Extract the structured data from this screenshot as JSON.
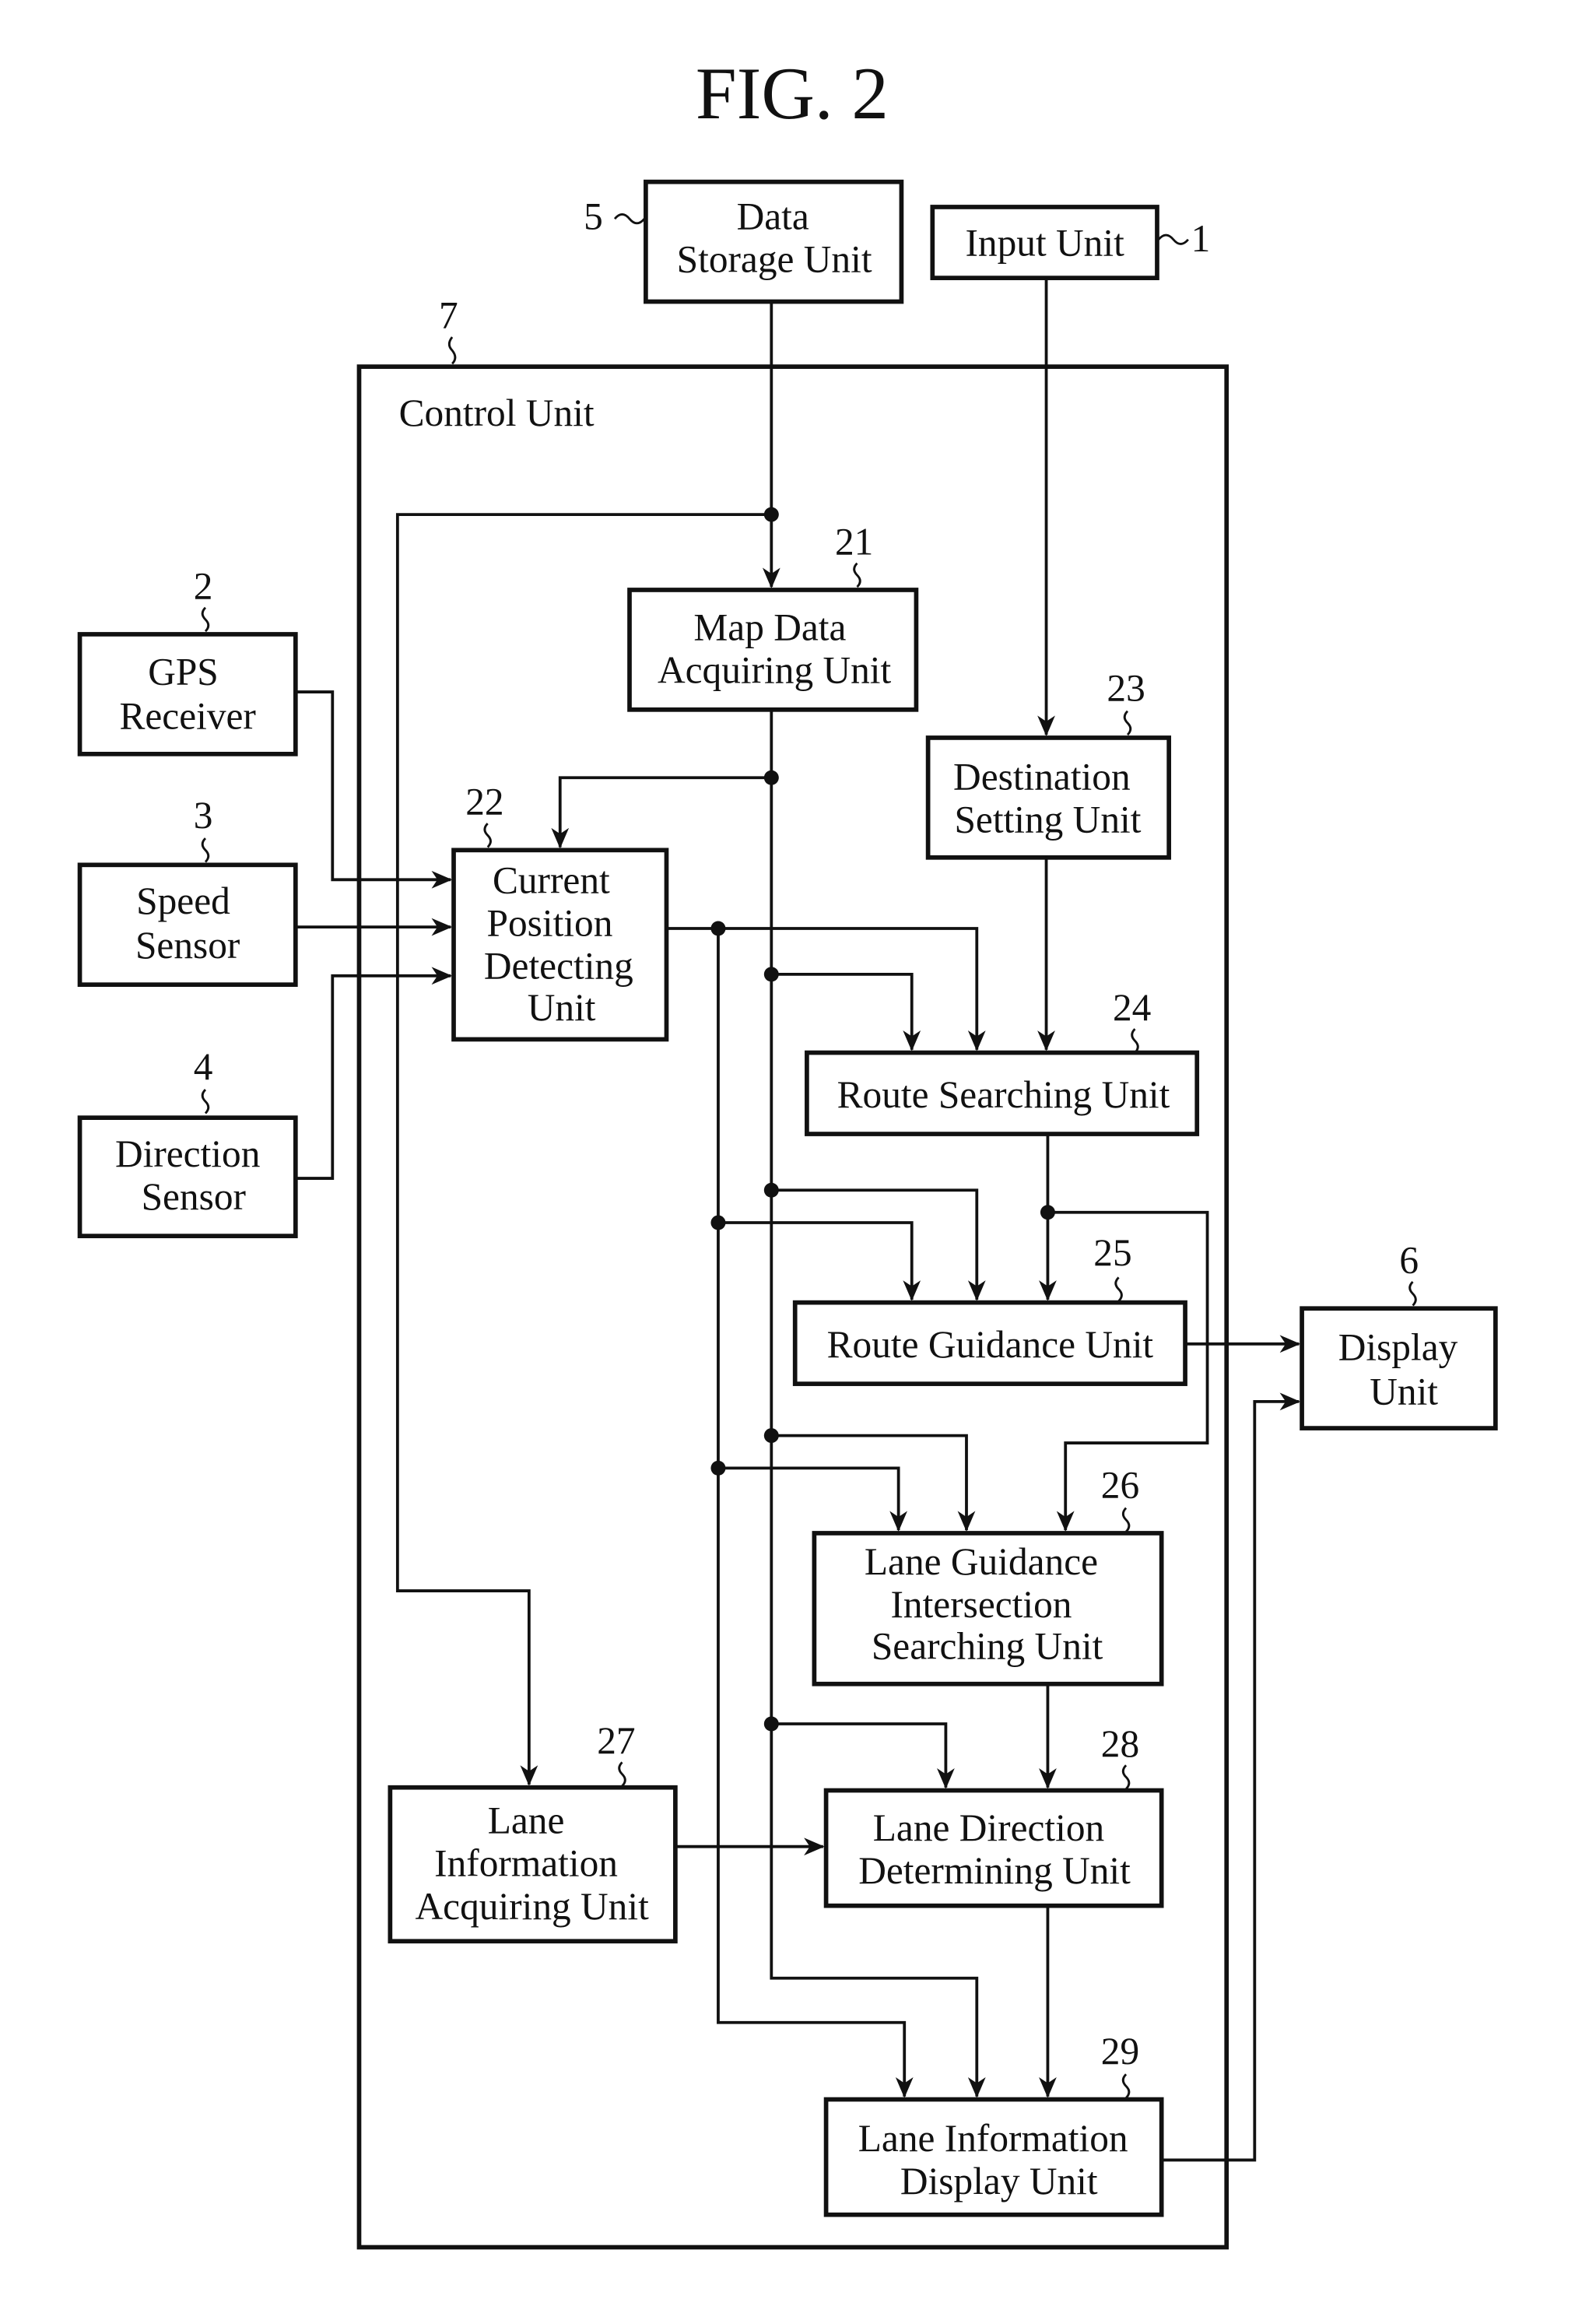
{
  "figure": {
    "title": "FIG. 2",
    "colors": {
      "ink": "#111111",
      "background": "#ffffff"
    }
  },
  "container": {
    "label": "Control Unit",
    "ref": "7"
  },
  "blocks": {
    "data_storage": {
      "ref": "5",
      "lines": [
        "Data",
        "Storage Unit"
      ]
    },
    "input": {
      "ref": "1",
      "lines": [
        "Input Unit"
      ]
    },
    "gps": {
      "ref": "2",
      "lines": [
        "GPS",
        "Receiver"
      ]
    },
    "speed": {
      "ref": "3",
      "lines": [
        "Speed",
        "Sensor"
      ]
    },
    "direction": {
      "ref": "4",
      "lines": [
        "Direction",
        "Sensor"
      ]
    },
    "map_data": {
      "ref": "21",
      "lines": [
        "Map Data",
        "Acquiring Unit"
      ]
    },
    "current_position": {
      "ref": "22",
      "lines": [
        "Current",
        "Position",
        "Detecting",
        "Unit"
      ]
    },
    "destination": {
      "ref": "23",
      "lines": [
        "Destination",
        "Setting Unit"
      ]
    },
    "route_search": {
      "ref": "24",
      "lines": [
        "Route Searching Unit"
      ]
    },
    "route_guidance": {
      "ref": "25",
      "lines": [
        "Route Guidance Unit"
      ]
    },
    "lane_guidance_search": {
      "ref": "26",
      "lines": [
        "Lane Guidance",
        "Intersection",
        "Searching Unit"
      ]
    },
    "lane_info_acquire": {
      "ref": "27",
      "lines": [
        "Lane",
        "Information",
        "Acquiring Unit"
      ]
    },
    "lane_direction": {
      "ref": "28",
      "lines": [
        "Lane Direction",
        "Determining Unit"
      ]
    },
    "lane_info_display": {
      "ref": "29",
      "lines": [
        "Lane Information",
        "Display Unit"
      ]
    },
    "display": {
      "ref": "6",
      "lines": [
        "Display",
        "Unit"
      ]
    }
  }
}
